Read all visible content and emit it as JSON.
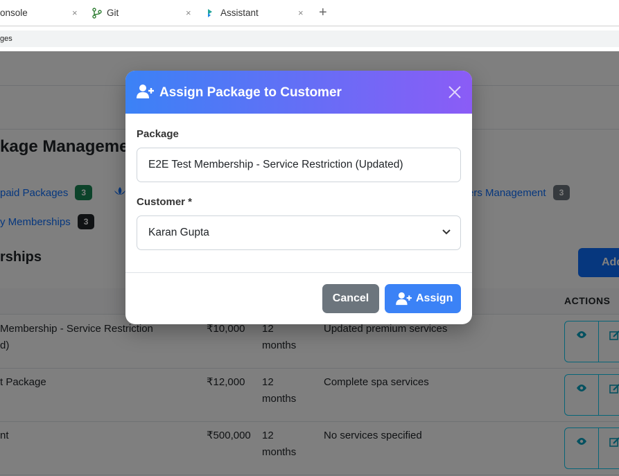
{
  "tabs": [
    {
      "label": "onsole",
      "close": "×"
    },
    {
      "label": "Git",
      "close": "×"
    },
    {
      "label": "Assistant",
      "close": "×"
    }
  ],
  "new_tab": "+",
  "url_fragment": "ges",
  "page": {
    "title": "kage Managemer",
    "nav": {
      "prepaid_label": "paid Packages",
      "prepaid_count": "3",
      "members_label": "ers Management",
      "members_count": "3",
      "memberships_label": "y Memberships",
      "memberships_count": "3"
    },
    "section_title": "rships",
    "add_button": "Add",
    "actions_header": "ACTIONS",
    "rows": [
      {
        "name_line1": "Membership - Service Restriction",
        "name_line2": "d)",
        "price": "₹10,000",
        "duration_line1": "12",
        "duration_line2": "months",
        "services": "Updated premium services"
      },
      {
        "name_line1": "t Package",
        "name_line2": "",
        "price": "₹12,000",
        "duration_line1": "12",
        "duration_line2": "months",
        "services": "Complete spa services"
      },
      {
        "name_line1": "nt",
        "name_line2": "",
        "price": "₹500,000",
        "duration_line1": "12",
        "duration_line2": "months",
        "services": "No services specified"
      }
    ]
  },
  "modal": {
    "title": "Assign Package to Customer",
    "package_label": "Package",
    "package_value": "E2E Test Membership - Service Restriction (Updated)",
    "customer_label": "Customer *",
    "customer_value": "Karan Gupta",
    "cancel_label": "Cancel",
    "assign_label": "Assign"
  },
  "icons": {
    "title_icon": "user-plus-icon",
    "close_icon": "close-icon",
    "select_icon": "chevron-down-icon",
    "assign_icon": "user-plus-icon",
    "view_icon": "eye-icon",
    "edit_icon": "edit-icon"
  },
  "colors": {
    "header_gradient_start": "#3b82f6",
    "header_gradient_end": "#8b5cf6",
    "primary": "#3b82f6",
    "cancel": "#6c757d",
    "badge_green": "#198754",
    "badge_dark": "#212529"
  }
}
